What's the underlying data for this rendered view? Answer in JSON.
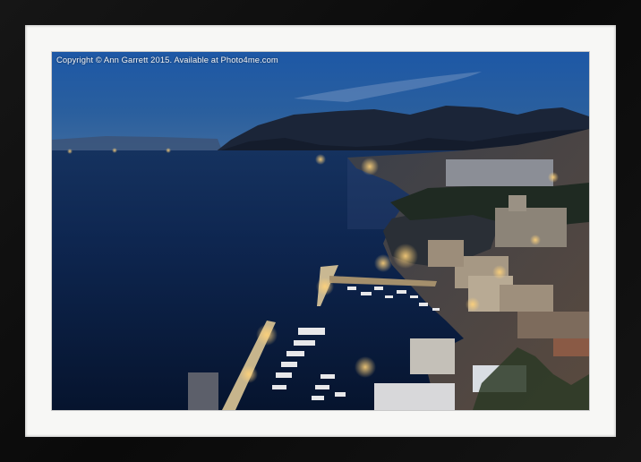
{
  "photo": {
    "copyright_text": "Copyright © Ann Garrett 2015. Available at Photo4me.com"
  },
  "colors": {
    "frame": "#111111",
    "mount": "#f7f7f5",
    "sky_top": "#1c4f94",
    "sea": "#0b2145",
    "mountains": "#1b2538",
    "lights": "#ffd27a"
  },
  "scene": {
    "subject": "coastal-town-at-dusk",
    "elements": [
      "sky",
      "mountains",
      "bay",
      "harbour",
      "town-lights",
      "boats",
      "pier"
    ]
  }
}
